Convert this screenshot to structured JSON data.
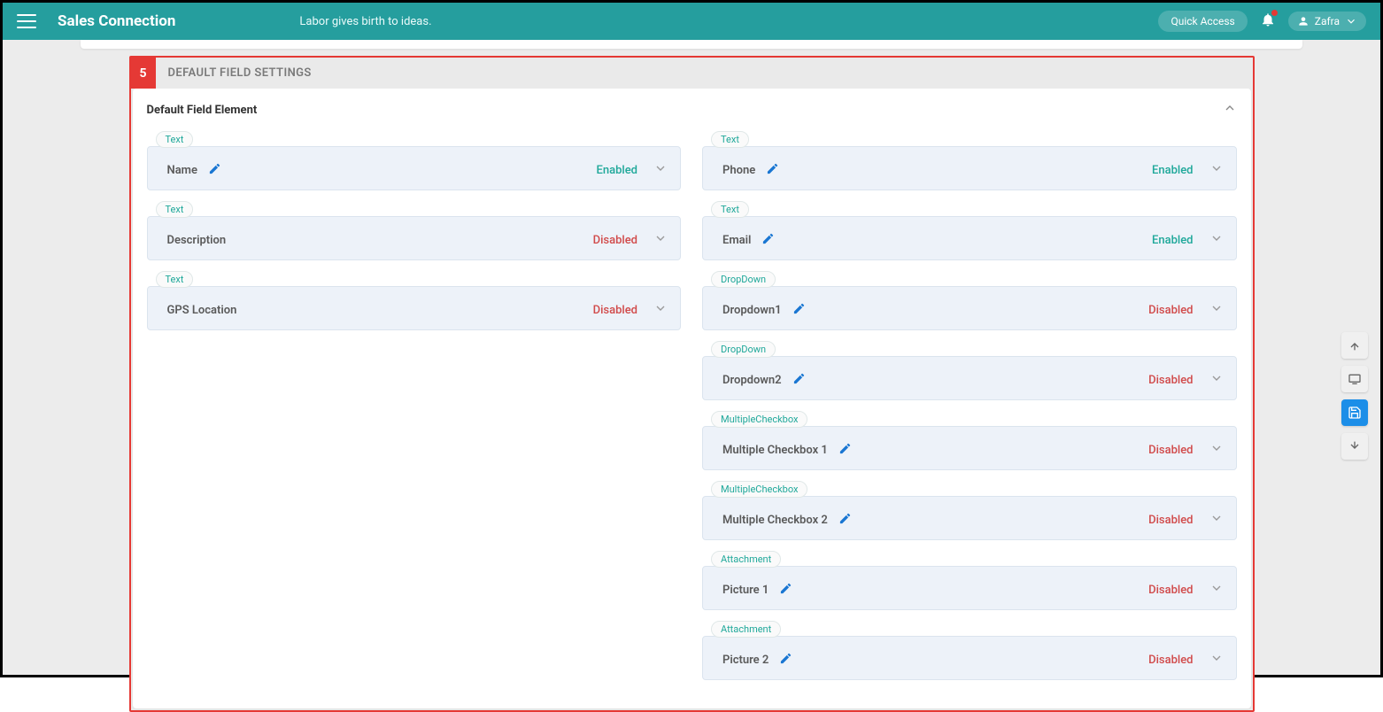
{
  "header": {
    "brand": "Sales Connection",
    "tagline": "Labor gives birth to ideas.",
    "quickAccess": "Quick Access",
    "user": "Zafra"
  },
  "section": {
    "step": "5",
    "title": "DEFAULT FIELD SETTINGS",
    "panelTitle": "Default Field Element"
  },
  "status": {
    "enabled": "Enabled",
    "disabled": "Disabled"
  },
  "leftFields": [
    {
      "type": "Text",
      "name": "Name",
      "status": "enabled",
      "editable": true
    },
    {
      "type": "Text",
      "name": "Description",
      "status": "disabled",
      "editable": false
    },
    {
      "type": "Text",
      "name": "GPS Location",
      "status": "disabled",
      "editable": false
    }
  ],
  "rightFields": [
    {
      "type": "Text",
      "name": "Phone",
      "status": "enabled",
      "editable": true
    },
    {
      "type": "Text",
      "name": "Email",
      "status": "enabled",
      "editable": true
    },
    {
      "type": "DropDown",
      "name": "Dropdown1",
      "status": "disabled",
      "editable": true
    },
    {
      "type": "DropDown",
      "name": "Dropdown2",
      "status": "disabled",
      "editable": true
    },
    {
      "type": "MultipleCheckbox",
      "name": "Multiple Checkbox 1",
      "status": "disabled",
      "editable": true
    },
    {
      "type": "MultipleCheckbox",
      "name": "Multiple Checkbox 2",
      "status": "disabled",
      "editable": true
    },
    {
      "type": "Attachment",
      "name": "Picture 1",
      "status": "disabled",
      "editable": true
    },
    {
      "type": "Attachment",
      "name": "Picture 2",
      "status": "disabled",
      "editable": true
    }
  ]
}
